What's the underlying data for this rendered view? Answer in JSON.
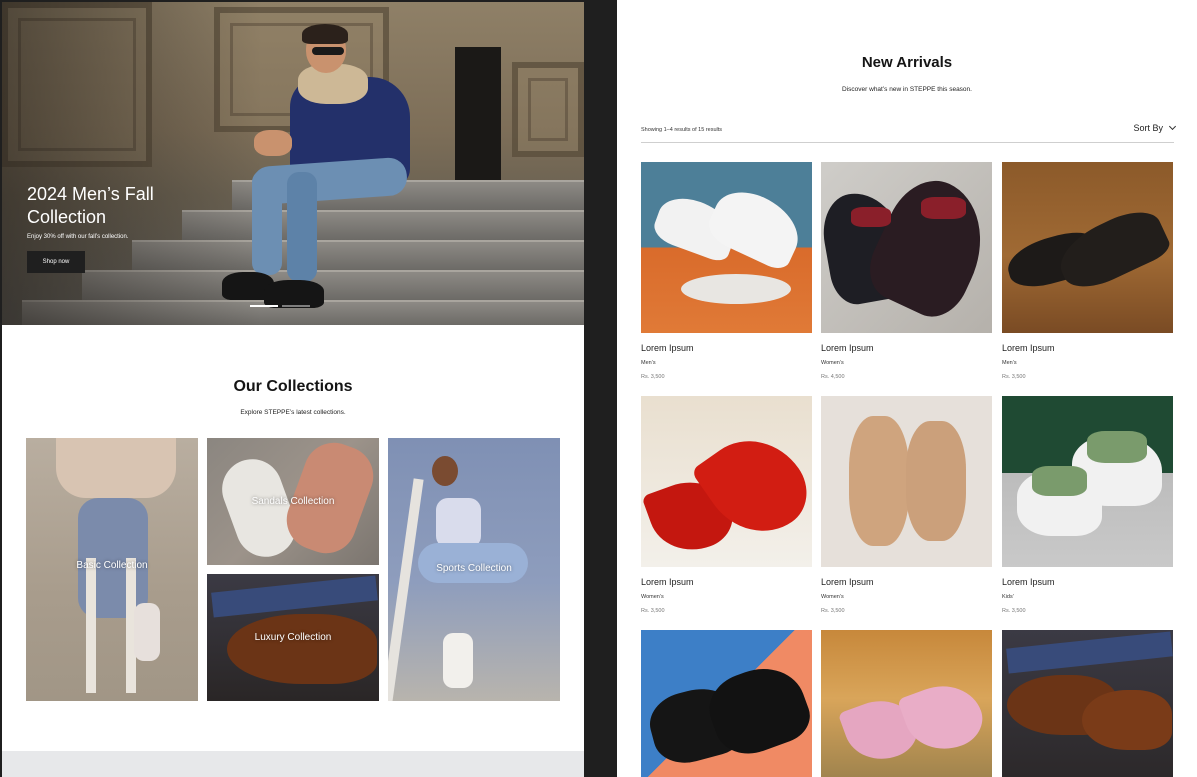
{
  "hero": {
    "title": "2024 Men’s Fall Collection",
    "subtitle": "Enjoy 30% off with our fall’s collection.",
    "button_label": "Shop now",
    "slide_count": 3,
    "active_slide": 1
  },
  "collections": {
    "title": "Our Collections",
    "subtitle": "Explore STEPPE’s latest collections.",
    "items": [
      {
        "label": "Basic Collection"
      },
      {
        "label": "Sandals Collection"
      },
      {
        "label": "Luxury Collection"
      },
      {
        "label": "Sports Collection"
      }
    ]
  },
  "new_arrivals": {
    "title": "New Arrivals",
    "subtitle": "Discover what’s new in STEPPE this season.",
    "results_text": "Showing 1–4 results of 15 results",
    "sort_label": "Sort By",
    "products": [
      {
        "name": "Lorem Ipsum",
        "category": "Men’s",
        "price": "Rs. 3,500"
      },
      {
        "name": "Lorem Ipsum",
        "category": "Women’s",
        "price": "Rs. 4,500"
      },
      {
        "name": "Lorem Ipsum",
        "category": "Men’s",
        "price": "Rs. 3,500"
      },
      {
        "name": "Lorem Ipsum",
        "category": "Women’s",
        "price": "Rs. 3,500"
      },
      {
        "name": "Lorem Ipsum",
        "category": "Women’s",
        "price": "Rs. 3,500"
      },
      {
        "name": "Lorem Ipsum",
        "category": "Kids’",
        "price": "Rs. 3,500"
      },
      {
        "name": "",
        "category": "",
        "price": ""
      },
      {
        "name": "",
        "category": "",
        "price": ""
      },
      {
        "name": "",
        "category": "",
        "price": ""
      }
    ]
  },
  "colors": {
    "dark": "#1f1f1f",
    "footer_strip": "#e7e8ea"
  }
}
